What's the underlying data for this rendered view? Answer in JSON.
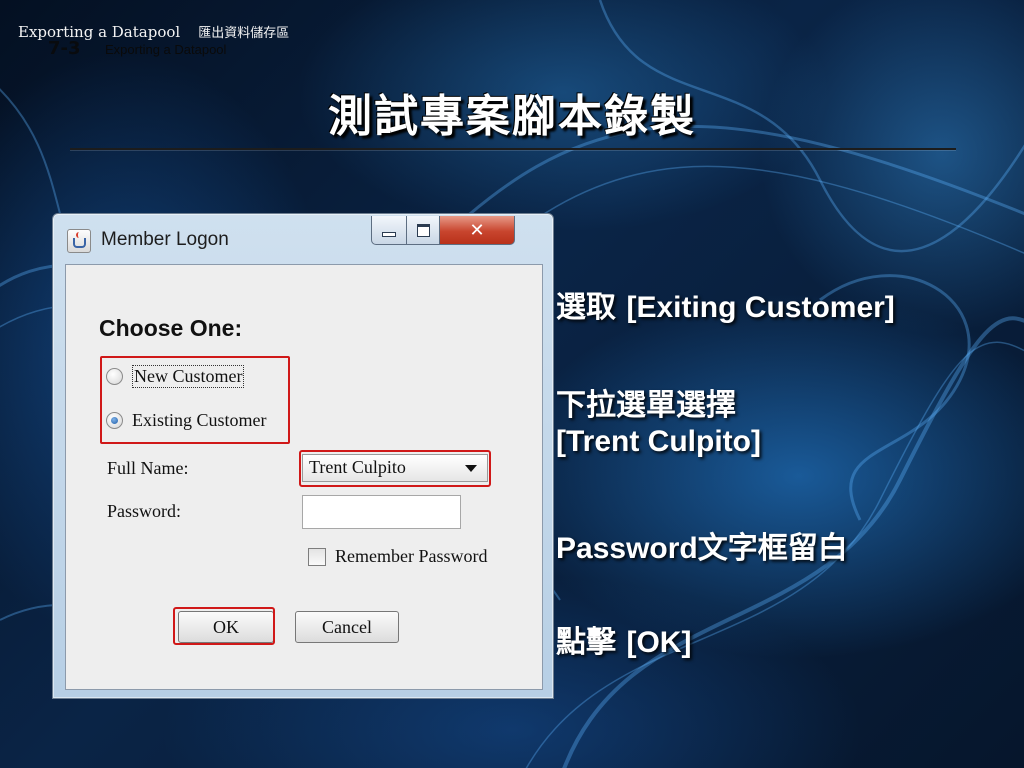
{
  "header": {
    "course_title_en": "Exporting a Datapool",
    "course_title_zh": "匯出資料儲存區",
    "section_number": "7-3",
    "section_subtitle": "Exporting a Datapool"
  },
  "slide_title": "測試專案腳本錄製",
  "window": {
    "title": "Member Logon",
    "title_icon": "java-cup-icon",
    "buttons": {
      "minimize": "minimize-icon",
      "maximize": "maximize-icon",
      "close_glyph": "✕"
    }
  },
  "form": {
    "heading": "Choose One:",
    "radio_options": [
      {
        "label": "New Customer",
        "selected": false
      },
      {
        "label": "Existing Customer",
        "selected": true
      }
    ],
    "full_name_label": "Full Name:",
    "full_name_value": "Trent Culpito",
    "password_label": "Password:",
    "password_value": "",
    "remember_label": "Remember Password",
    "remember_checked": false,
    "ok_label": "OK",
    "cancel_label": "Cancel"
  },
  "highlight_color": "#d01818",
  "instructions": {
    "step1_zh": "選取",
    "step1_en": "[Exiting Customer]",
    "step2_zh": "下拉選單選擇",
    "step2_en": "[Trent Culpito]",
    "step3_en": "Password",
    "step3_zh": "文字框留白",
    "step4_zh": "點擊",
    "step4_en": "[OK]"
  }
}
